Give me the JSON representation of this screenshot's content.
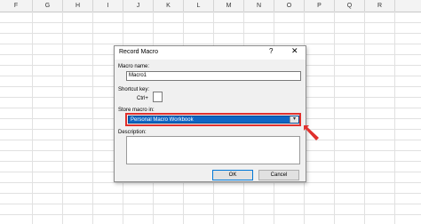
{
  "sheet": {
    "columns": [
      "F",
      "G",
      "H",
      "I",
      "J",
      "K",
      "L",
      "M",
      "N",
      "O",
      "P",
      "Q",
      "R"
    ]
  },
  "dialog": {
    "title": "Record Macro",
    "help_glyph": "?",
    "close_glyph": "✕",
    "macro_name_label": "Macro name:",
    "macro_name_value": "Macro1",
    "shortcut_label": "Shortcut key:",
    "ctrl_label": "Ctrl+",
    "store_label": "Store macro in:",
    "store_value": "Personal Macro Workbook",
    "description_label": "Description:",
    "ok_label": "OK",
    "cancel_label": "Cancel"
  },
  "colors": {
    "highlight": "#e0302d",
    "selection": "#0f66c4"
  },
  "icons": {
    "pointer": "red-arrow-icon"
  }
}
